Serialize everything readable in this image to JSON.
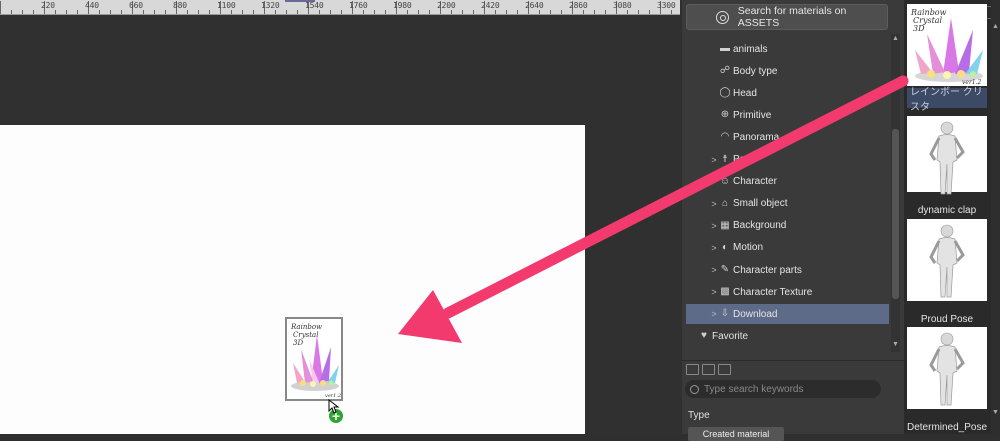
{
  "ruler": {
    "labels": [
      "220",
      "440",
      "660",
      "880",
      "1100",
      "1320",
      "1540",
      "1760",
      "1980",
      "2200",
      "2420",
      "2640",
      "2860",
      "3080",
      "3300"
    ]
  },
  "panel": {
    "search_button": "Search for materials on ASSETS",
    "tree": [
      {
        "label": "animals",
        "icon": "folder-icon",
        "chevron": "",
        "selected": false
      },
      {
        "label": "Body type",
        "icon": "body-type-icon",
        "chevron": "",
        "selected": false
      },
      {
        "label": "Head",
        "icon": "head-icon",
        "chevron": "",
        "selected": false
      },
      {
        "label": "Primitive",
        "icon": "primitive-icon",
        "chevron": "",
        "selected": false
      },
      {
        "label": "Panorama",
        "icon": "panorama-icon",
        "chevron": "",
        "selected": false
      },
      {
        "label": "Pose",
        "icon": "pose-icon",
        "chevron": ">",
        "selected": false
      },
      {
        "label": "Character",
        "icon": "character-icon",
        "chevron": "",
        "selected": false
      },
      {
        "label": "Small object",
        "icon": "small-object-icon",
        "chevron": ">",
        "selected": false
      },
      {
        "label": "Background",
        "icon": "background-icon",
        "chevron": ">",
        "selected": false
      },
      {
        "label": "Motion",
        "icon": "motion-icon",
        "chevron": ">",
        "selected": false
      },
      {
        "label": "Character parts",
        "icon": "character-parts-icon",
        "chevron": ">",
        "selected": false
      },
      {
        "label": "Character Texture",
        "icon": "texture-icon",
        "chevron": ">",
        "selected": false
      },
      {
        "label": "Download",
        "icon": "download-icon",
        "chevron": ">",
        "selected": true
      },
      {
        "label": "Favorite",
        "icon": "heart-icon",
        "chevron": "",
        "selected": false
      }
    ],
    "search_placeholder": "Type search keywords",
    "type_label": "Type",
    "created_material": "Created material"
  },
  "thumbnails": [
    {
      "title": "レインボー クリスタ",
      "kind": "crystal",
      "selected": true
    },
    {
      "title": "dynamic clap",
      "kind": "figure",
      "selected": false
    },
    {
      "title": "Proud Pose",
      "kind": "figure",
      "selected": false
    },
    {
      "title": "Determined_Pose",
      "kind": "figure",
      "selected": false
    }
  ],
  "crystal_art": {
    "line1": "Rainbow",
    "line2": "Crystal",
    "line3": "3D",
    "version": "ver1.2"
  },
  "colors": {
    "arrow": "#f23a6e",
    "selection": "#5d6b88",
    "plus_badge": "#2ea52e"
  }
}
